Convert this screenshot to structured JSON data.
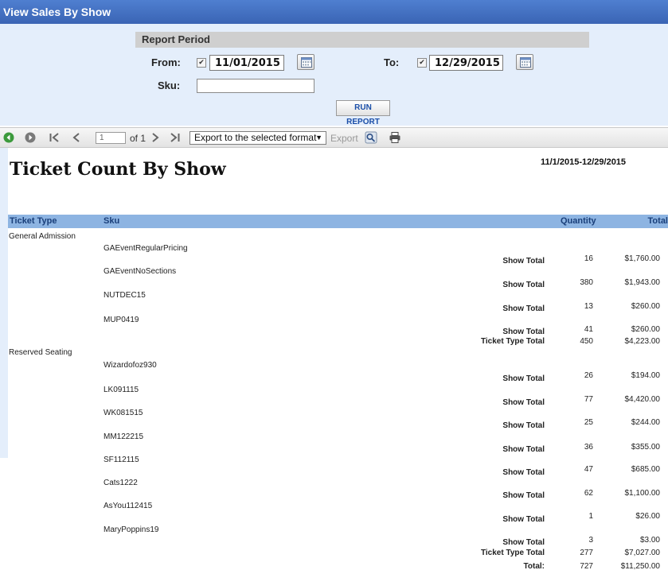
{
  "window": {
    "title": "View Sales By Show"
  },
  "params": {
    "period_label": "Report Period",
    "from_label": "From:",
    "from_value": "11/01/2015",
    "to_label": "To:",
    "to_value": "12/29/2015",
    "sku_label": "Sku:",
    "sku_value": "",
    "run_label": "RUN REPORT"
  },
  "toolbar": {
    "page_value": "1",
    "of_text": "of 1",
    "export_format": "Export to the selected format",
    "export_label": "Export"
  },
  "report": {
    "title": "Ticket Count By Show",
    "date_range": "11/1/2015-12/29/2015",
    "columns": {
      "type": "Ticket Type",
      "sku": "Sku",
      "quantity": "Quantity",
      "total": "Total"
    },
    "show_total_label": "Show Total",
    "type_total_label": "Ticket Type Total",
    "grand_total_label": "Total:",
    "groups": [
      {
        "type": "General Admission",
        "rows": [
          {
            "sku": "GAEventRegularPricing",
            "quantity": "16",
            "total": "$1,760.00"
          },
          {
            "sku": "GAEventNoSections",
            "quantity": "380",
            "total": "$1,943.00"
          },
          {
            "sku": "NUTDEC15",
            "quantity": "13",
            "total": "$260.00"
          },
          {
            "sku": "MUP0419",
            "quantity": "41",
            "total": "$260.00"
          }
        ],
        "type_total_quantity": "450",
        "type_total_amount": "$4,223.00"
      },
      {
        "type": "Reserved Seating",
        "rows": [
          {
            "sku": "Wizardofoz930",
            "quantity": "26",
            "total": "$194.00"
          },
          {
            "sku": "LK091115",
            "quantity": "77",
            "total": "$4,420.00"
          },
          {
            "sku": "WK081515",
            "quantity": "25",
            "total": "$244.00"
          },
          {
            "sku": "MM122215",
            "quantity": "36",
            "total": "$355.00"
          },
          {
            "sku": "SF112115",
            "quantity": "47",
            "total": "$685.00"
          },
          {
            "sku": "Cats1222",
            "quantity": "62",
            "total": "$1,100.00"
          },
          {
            "sku": "AsYou112415",
            "quantity": "1",
            "total": "$26.00"
          },
          {
            "sku": "MaryPoppins19",
            "quantity": "3",
            "total": "$3.00"
          }
        ],
        "type_total_quantity": "277",
        "type_total_amount": "$7,027.00"
      }
    ],
    "grand_total_quantity": "727",
    "grand_total_amount": "$11,250.00"
  }
}
